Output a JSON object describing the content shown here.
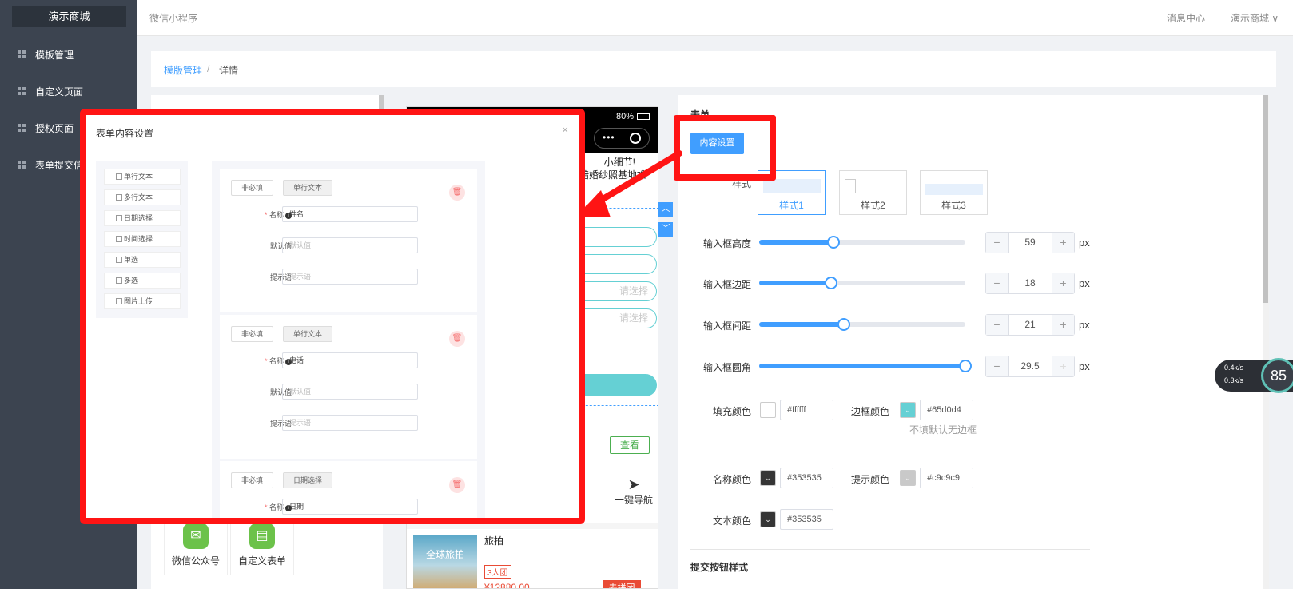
{
  "sidebar": {
    "logo": "演示商城",
    "items": [
      {
        "label": "模板管理"
      },
      {
        "label": "自定义页面"
      },
      {
        "label": "授权页面"
      },
      {
        "label": "表单提交信"
      }
    ]
  },
  "topbar": {
    "subtitle": "微信小程序",
    "message_center": "消息中心",
    "shop_menu": "演示商城 ∨"
  },
  "breadcrumb": {
    "link": "模版管理",
    "separator": "/",
    "current": "详情"
  },
  "components": [
    {
      "label": "微信公众号",
      "icon": "wechat-icon"
    },
    {
      "label": "自定义表单",
      "icon": "form-icon"
    }
  ],
  "phone": {
    "battery": "80%",
    "notice_line1": "小细节!",
    "notice_line2": "暗婚纱照基地推",
    "fields": [
      {
        "placeholder": ""
      },
      {
        "placeholder": ""
      },
      {
        "placeholder": "请选择"
      },
      {
        "placeholder": "请选择"
      }
    ],
    "view_button": "查看",
    "nav_label": "一键导航",
    "product": {
      "image_text": "全球旅拍",
      "title": "旅拍",
      "tag": "3人团",
      "price": "¥12880.00",
      "button": "去拼团"
    }
  },
  "settings": {
    "section_title": "表单",
    "content_button": "内容设置",
    "style_label": "样式",
    "styles": [
      "样式1",
      "样式2",
      "样式3"
    ],
    "selected_style": 0,
    "sliders": [
      {
        "label": "输入框高度",
        "value": "59",
        "unit": "px",
        "fraction": 0.36
      },
      {
        "label": "输入框边距",
        "value": "18",
        "unit": "px",
        "fraction": 0.35
      },
      {
        "label": "输入框间距",
        "value": "21",
        "unit": "px",
        "fraction": 0.41
      },
      {
        "label": "输入框圆角",
        "value": "29.5",
        "unit": "px",
        "fraction": 1.0
      }
    ],
    "stepper_minus": "−",
    "stepper_plus": "+",
    "colors": {
      "fill_label": "填充颜色",
      "fill_value": "#ffffff",
      "border_label": "边框颜色",
      "border_value": "#65d0d4",
      "border_hint": "不填默认无边框",
      "name_label": "名称颜色",
      "name_value": "#353535",
      "hint_label": "提示颜色",
      "hint_value": "#c9c9c9",
      "text_label": "文本颜色",
      "text_value": "#353535"
    },
    "submit_section": "提交按钮样式"
  },
  "speed": {
    "up": "0.4k/s",
    "down": "0.3k/s",
    "percent": "85"
  },
  "modal": {
    "title": "表单内容设置",
    "close": "×",
    "options": [
      "单行文本",
      "多行文本",
      "日期选择",
      "时间选择",
      "单选",
      "多选",
      "图片上传"
    ],
    "cards": [
      {
        "required": "非必填",
        "type": "单行文本",
        "name_label": "名称",
        "name_value": "姓名",
        "default_label": "默认值",
        "default_placeholder": "默认值",
        "tip_label": "提示语",
        "tip_placeholder": "提示语"
      },
      {
        "required": "非必填",
        "type": "单行文本",
        "name_label": "名称",
        "name_value": "电话",
        "default_label": "默认值",
        "default_placeholder": "默认值",
        "tip_label": "提示语",
        "tip_placeholder": "提示语"
      },
      {
        "required": "非必填",
        "type": "日期选择",
        "name_label": "名称",
        "name_value": "日期",
        "default_label": "",
        "default_placeholder": "",
        "tip_label": "",
        "tip_placeholder": ""
      }
    ]
  },
  "theme": {
    "accent": "#409eff",
    "annotation": "#ff1414",
    "sidebar_bg": "#3c4450",
    "field_border": "#65d0d4"
  }
}
